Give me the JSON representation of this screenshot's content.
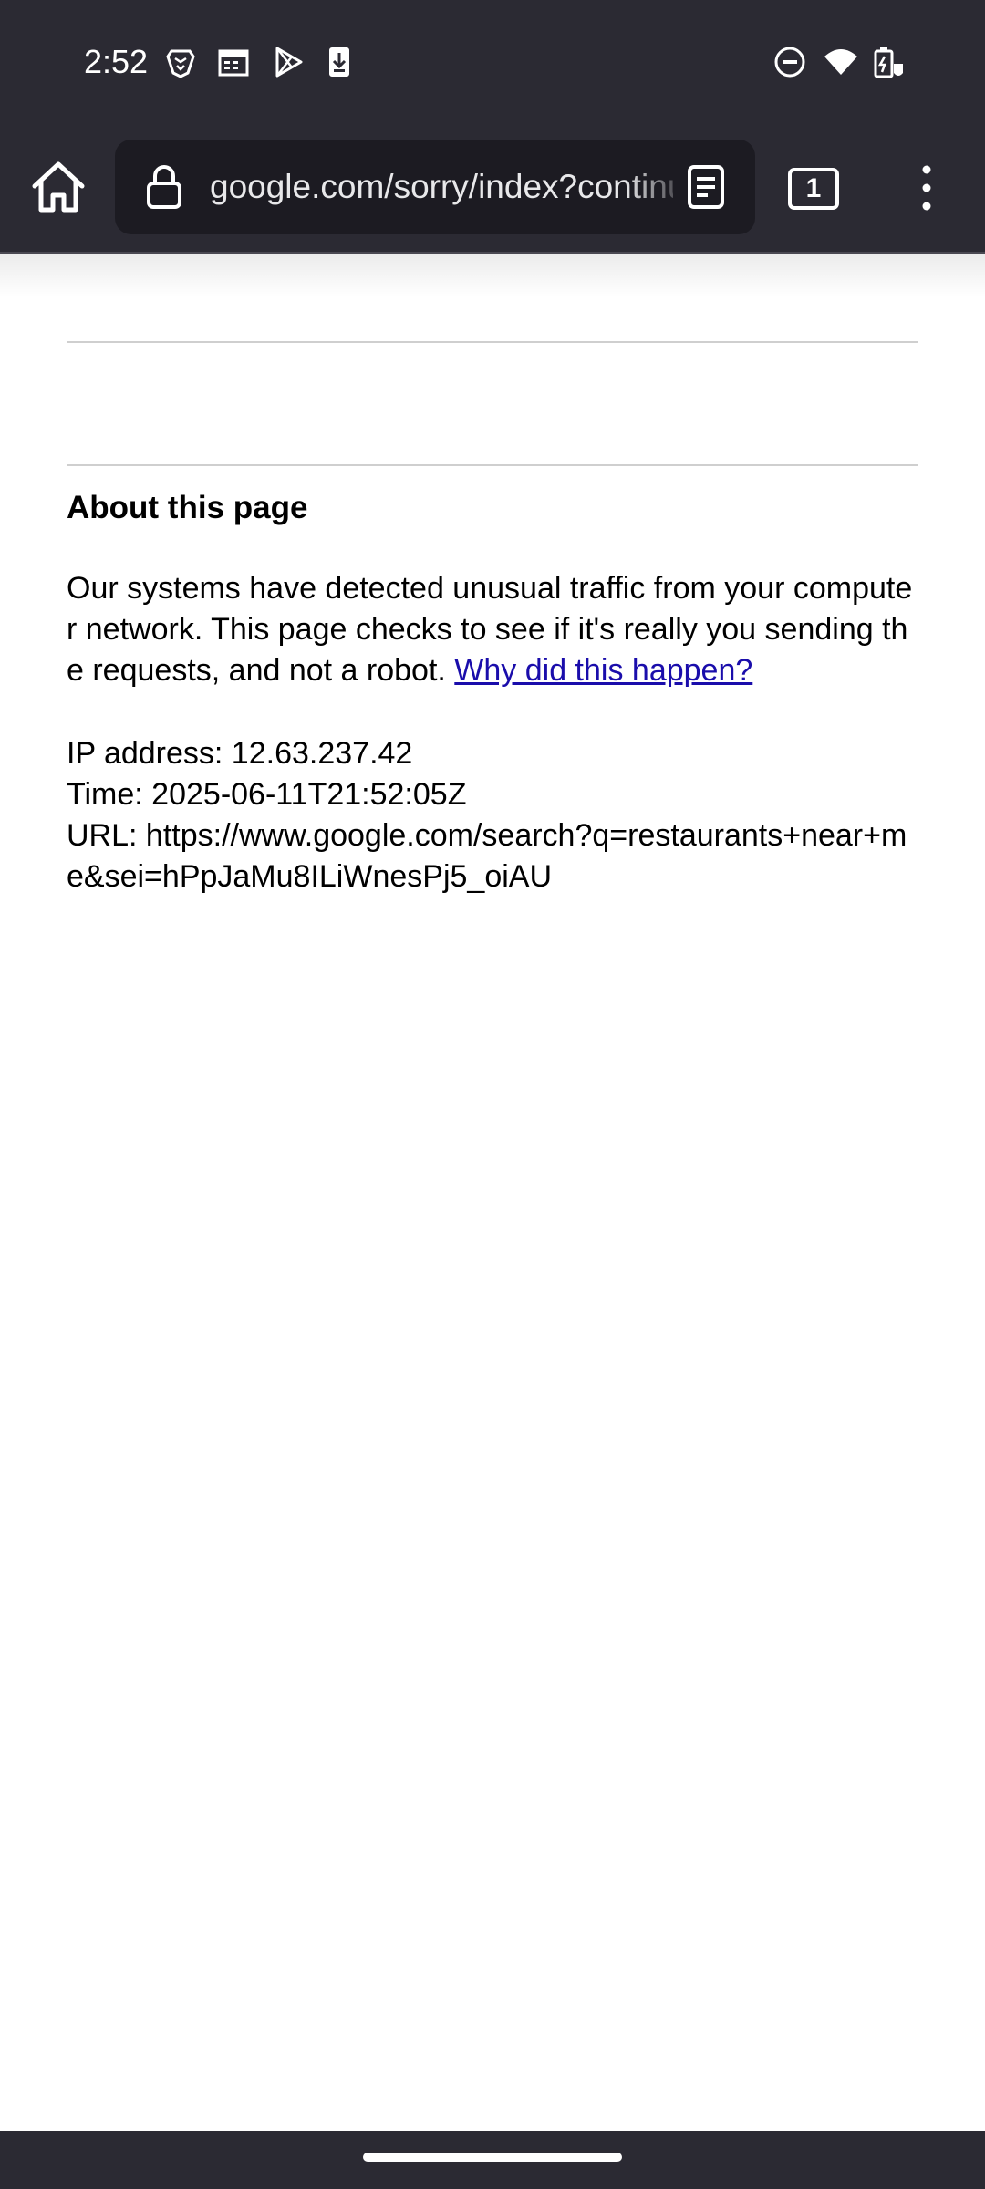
{
  "status_bar": {
    "time": "2:52",
    "left_icons": [
      "brave-icon",
      "calendar-icon",
      "play-store-icon",
      "download-icon"
    ],
    "right_icons": [
      "do-not-disturb-icon",
      "wifi-icon",
      "battery-charging-icon"
    ]
  },
  "toolbar": {
    "url": "google.com/sorry/index?continue",
    "tab_count": "1"
  },
  "page": {
    "heading": "About this page",
    "paragraph": "Our systems have detected unusual traffic from your computer network. This page checks to see if it's really you sending the requests, and not a robot.",
    "link_text": "Why did this happen?",
    "ip_line": "IP address: 12.63.237.42",
    "time_line": "Time: 2025-06-11T21:52:05Z",
    "url_line": "URL: https://www.google.com/search?q=restaurants+near+me&sei=hPpJaMu8ILiWnesPj5_oiAU"
  },
  "colors": {
    "chrome_background": "#2b2a33",
    "url_field_background": "#1c1b22",
    "link": "#1a0dab"
  }
}
